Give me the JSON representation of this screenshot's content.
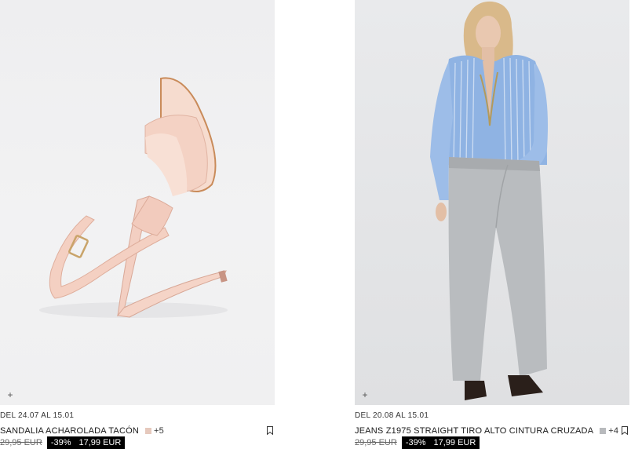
{
  "products": [
    {
      "date": "DEL 24.07 AL 15.01",
      "name": "SANDALIA ACHAROLADA TACÓN",
      "swatch_color": "#e6c9bd",
      "more_colors": "+5",
      "old_price": "29,95 EUR",
      "discount": "-39%",
      "price": "17,99 EUR",
      "add_icon": "plus-icon",
      "bookmark_icon": "bookmark-icon"
    },
    {
      "date": "DEL 20.08 AL 15.01",
      "name": "JEANS Z1975 STRAIGHT TIRO ALTO CINTURA CRUZADA",
      "swatch_color": "#b8babd",
      "more_colors": "+4",
      "old_price": "29,95 EUR",
      "discount": "-39%",
      "price": "17,99 EUR",
      "add_icon": "plus-icon",
      "bookmark_icon": "bookmark-icon"
    }
  ],
  "add_symbol": "+"
}
